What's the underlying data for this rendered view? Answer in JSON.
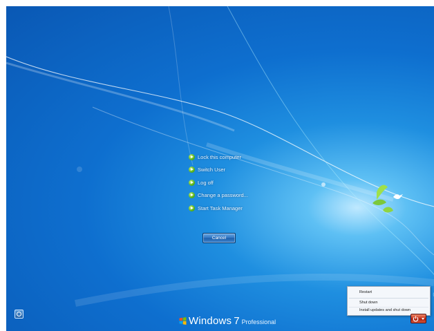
{
  "menu": {
    "items": [
      {
        "label": "Lock this computer",
        "icon": "green-arrow-icon"
      },
      {
        "label": "Switch User",
        "icon": "green-arrow-icon"
      },
      {
        "label": "Log off",
        "icon": "green-arrow-icon"
      },
      {
        "label": "Change a password...",
        "icon": "green-arrow-icon"
      },
      {
        "label": "Start Task Manager",
        "icon": "green-arrow-icon"
      }
    ]
  },
  "cancel_button": {
    "label": "Cancel"
  },
  "branding": {
    "windows": "Windows",
    "version": "7",
    "edition": "Professional"
  },
  "shutdown_menu": {
    "items": [
      {
        "label": "Restart"
      },
      {
        "label": "Shut down"
      },
      {
        "label": "Install updates and shut down"
      }
    ]
  },
  "icons": {
    "ease_of_access": "ease-of-access-icon",
    "power": "power-icon",
    "power_options": "chevron-down-icon",
    "logo": "windows-flag-icon",
    "bird": "bird-icon"
  },
  "colors": {
    "background": "#0e6fcf",
    "glow": "#bfe9ff",
    "power_button": "#c3311c",
    "menu_arrow": "#58b21a"
  }
}
